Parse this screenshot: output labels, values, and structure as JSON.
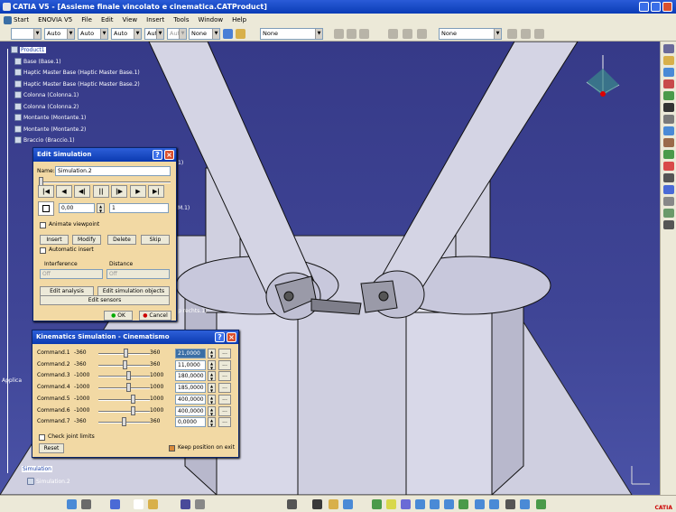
{
  "window": {
    "title": "CATIA V5 - [Assieme finale vincolato e cinematica.CATProduct]"
  },
  "menu": [
    "Start",
    "ENOVIA V5",
    "File",
    "Edit",
    "View",
    "Insert",
    "Tools",
    "Window",
    "Help"
  ],
  "toolbar": {
    "sel1": "",
    "sel2": "Auto",
    "sel3": "Auto",
    "sel4": "Auto",
    "sel5": "Aut",
    "sel6": "Aut",
    "sel7": "None",
    "sel8": "None",
    "sel9": "None"
  },
  "tree": {
    "items": [
      "Product1",
      "Base (Base.1)",
      "Haptic Master Base (Haptic Master Base.1)",
      "Haptic Master Base (Haptic Master Base.2)",
      "Colonna (Colonna.1)",
      "Colonna (Colonna.2)",
      "Montante (Montante.1)",
      "Montante (Montante.2)",
      "Braccio (Braccio.1)"
    ],
    "frag1": "1)",
    "frag2": "M.1)",
    "frag3": "p rechts.1)",
    "sim_label": "Simulation",
    "sim_child": "Simulation.2",
    "side_frag": "Applica"
  },
  "edit_sim": {
    "title": "Edit Simulation",
    "name_label": "Name:",
    "name_value": "Simulation.2",
    "time": "0,00",
    "step": "1",
    "animate_label": "Animate viewpoint",
    "insert": "Insert",
    "modify": "Modify",
    "delete": "Delete",
    "skip": "Skip",
    "auto_insert": "Automatic insert",
    "interference": "Interference",
    "distance": "Distance",
    "off1": "Off",
    "off2": "Off",
    "edit_analysis": "Edit analysis",
    "edit_objects": "Edit simulation objects",
    "edit_sensors": "Edit sensors",
    "ok": "OK",
    "cancel": "Cancel"
  },
  "kin": {
    "title": "Kinematics Simulation - Cinematismo",
    "commands": [
      {
        "name": "Command.1",
        "min": "-360",
        "max": "360",
        "value": "21,0000",
        "pos": 0.53
      },
      {
        "name": "Command.2",
        "min": "-360",
        "max": "360",
        "value": "11,0000",
        "pos": 0.52
      },
      {
        "name": "Command.3",
        "min": "-1000",
        "max": "1000",
        "value": "180,0000",
        "pos": 0.59
      },
      {
        "name": "Command.4",
        "min": "-1000",
        "max": "1000",
        "value": "185,0000",
        "pos": 0.59
      },
      {
        "name": "Command.5",
        "min": "-1000",
        "max": "1000",
        "value": "400,0000",
        "pos": 0.7
      },
      {
        "name": "Command.6",
        "min": "-1000",
        "max": "1000",
        "value": "400,0000",
        "pos": 0.7
      },
      {
        "name": "Command.7",
        "min": "-360",
        "max": "360",
        "value": "0,0000",
        "pos": 0.5
      }
    ],
    "check_limits": "Check joint limits",
    "reset": "Reset",
    "keep": "Keep position on exit"
  },
  "catia_logo": "CATIA"
}
